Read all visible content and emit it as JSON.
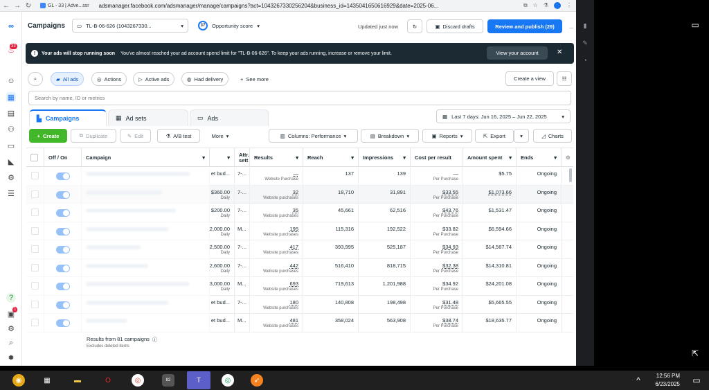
{
  "browser": {
    "tab_title": "GL - 33 | Adve...ssr",
    "url": "adsmanager.facebook.com/adsmanager/manage/campaigns?act=1043267330256204&business_id=1435041650616929&date=2025-06..."
  },
  "header": {
    "title": "Campaigns",
    "account": "TL-B-06-626 (1043267330...",
    "opportunity_score": "37",
    "opportunity_label": "Opportunity score",
    "updated": "Updated just now",
    "discard": "Discard drafts",
    "review": "Review and publish (29)",
    "more": "..."
  },
  "alert": {
    "title": "Your ads will stop running soon",
    "message": "You've almost reached your ad account spend limit for \"TL-B-06-626\". To keep your ads running, increase or remove your limit.",
    "button": "View your account"
  },
  "filters": {
    "all_ads": "All ads",
    "actions": "Actions",
    "active_ads": "Active ads",
    "had_delivery": "Had delivery",
    "see_more": "See more",
    "create_view": "Create a view"
  },
  "search": {
    "placeholder": "Search by name, ID or metrics"
  },
  "tabs": {
    "campaigns": "Campaigns",
    "ad_sets": "Ad sets",
    "ads": "Ads",
    "date_range": "Last 7 days: Jun 16, 2025 – Jun 22, 2025"
  },
  "toolbar": {
    "create": "Create",
    "duplicate": "Duplicate",
    "edit": "Edit",
    "ab_test": "A/B test",
    "more": "More",
    "columns": "Columns: Performance",
    "breakdown": "Breakdown",
    "reports": "Reports",
    "export": "Export",
    "charts": "Charts"
  },
  "table": {
    "headers": {
      "onoff": "Off / On",
      "campaign": "Campaign",
      "attr": "Attr. sett",
      "results": "Results",
      "reach": "Reach",
      "impressions": "Impressions",
      "cost": "Cost per result",
      "amount": "Amount spent",
      "ends": "Ends"
    },
    "rows": [
      {
        "budget": "et bud...",
        "budget_sub": "",
        "attr": "7-...",
        "results": "—",
        "results_sub": "Website Purchase",
        "reach": "137",
        "impressions": "139",
        "cost": "—",
        "cost_sub": "Per Purchase",
        "amount": "$5.75",
        "ends": "Ongoing"
      },
      {
        "budget": "$360.00",
        "budget_sub": "Daily",
        "attr": "7-...",
        "results": "32",
        "results_sub": "Website purchases",
        "reach": "18,710",
        "impressions": "31,891",
        "cost": "$33.55",
        "cost_sub": "Per Purchase",
        "amount": "$1,073.66",
        "ends": "Ongoing"
      },
      {
        "budget": "$200.00",
        "budget_sub": "Daily",
        "attr": "7-...",
        "results": "35",
        "results_sub": "Website purchases",
        "reach": "45,661",
        "impressions": "62,516",
        "cost": "$43.76",
        "cost_sub": "Per Purchase",
        "amount": "$1,531.47",
        "ends": "Ongoing"
      },
      {
        "budget": "2,000.00",
        "budget_sub": "Daily",
        "attr": "M...",
        "results": "195",
        "results_sub": "Website purchases",
        "reach": "115,316",
        "impressions": "192,522",
        "cost": "$33.82",
        "cost_sub": "Per Purchase",
        "amount": "$6,594.66",
        "ends": "Ongoing"
      },
      {
        "budget": "2,500.00",
        "budget_sub": "Daily",
        "attr": "7-...",
        "results": "417",
        "results_sub": "Website purchases",
        "reach": "393,995",
        "impressions": "525,187",
        "cost": "$34.93",
        "cost_sub": "Per Purchase",
        "amount": "$14,567.74",
        "ends": "Ongoing"
      },
      {
        "budget": "2,600.00",
        "budget_sub": "Daily",
        "attr": "7-...",
        "results": "442",
        "results_sub": "Website purchases",
        "reach": "516,410",
        "impressions": "818,715",
        "cost": "$32.38",
        "cost_sub": "Per Purchase",
        "amount": "$14,310.81",
        "ends": "Ongoing"
      },
      {
        "budget": "3,000.00",
        "budget_sub": "Daily",
        "attr": "M...",
        "results": "693",
        "results_sub": "Website purchases",
        "reach": "719,613",
        "impressions": "1,201,988",
        "cost": "$34.92",
        "cost_sub": "Per Purchase",
        "amount": "$24,201.08",
        "ends": "Ongoing"
      },
      {
        "budget": "et bud...",
        "budget_sub": "",
        "attr": "7-...",
        "results": "180",
        "results_sub": "Website purchases",
        "reach": "140,808",
        "impressions": "198,498",
        "cost": "$31.48",
        "cost_sub": "Per Purchase",
        "amount": "$5,665.55",
        "ends": "Ongoing"
      },
      {
        "budget": "et bud...",
        "budget_sub": "",
        "attr": "M...",
        "results": "481",
        "results_sub": "Website purchases",
        "reach": "358,024",
        "impressions": "563,908",
        "cost": "$38.74",
        "cost_sub": "Per Purchase",
        "amount": "$18,635.77",
        "ends": "Ongoing"
      }
    ],
    "footer": {
      "results": "Results from 81 campaigns",
      "excludes": "Excludes deleted items"
    }
  },
  "nav": {
    "notif_count": "33",
    "help_count": "1"
  },
  "taskbar": {
    "time": "12:56 PM",
    "date": "6/23/2025",
    "badge": "82"
  }
}
